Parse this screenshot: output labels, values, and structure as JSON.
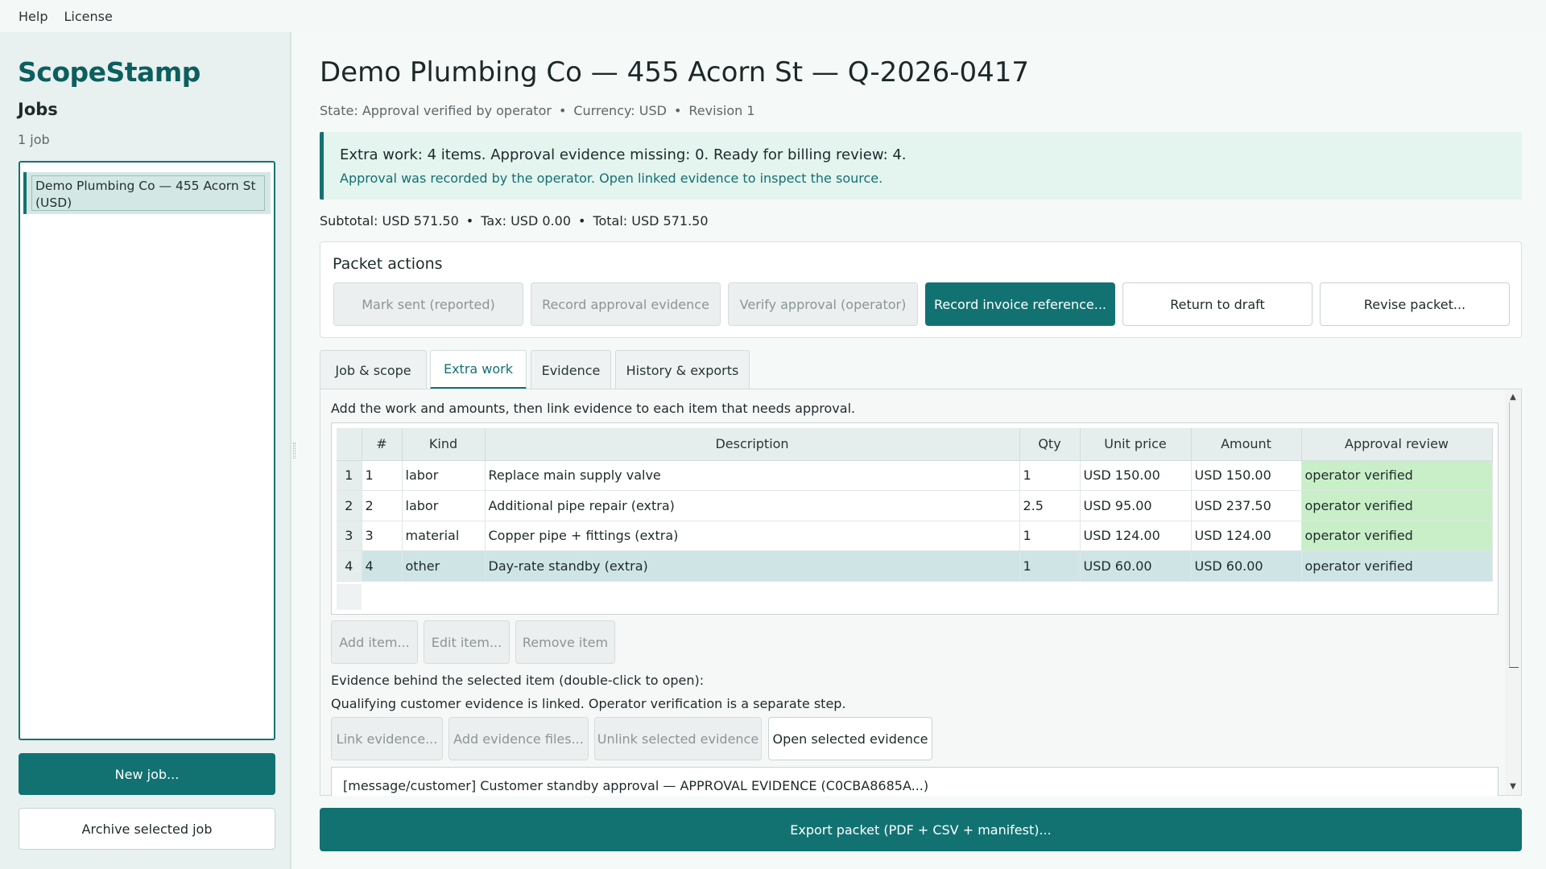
{
  "menubar": {
    "items": [
      "Help",
      "License"
    ]
  },
  "sidebar": {
    "brand": "ScopeStamp",
    "heading": "Jobs",
    "count": "1 job",
    "jobs": [
      {
        "label": "Demo Plumbing Co — 455 Acorn St (USD)"
      }
    ],
    "new_job": "New job...",
    "archive": "Archive selected job"
  },
  "main": {
    "title": "Demo Plumbing Co — 455 Acorn St — Q-2026-0417",
    "meta": {
      "state": "State: Approval verified by operator",
      "currency": "Currency: USD",
      "revision": "Revision 1",
      "sep": "•"
    },
    "banner": {
      "headline": "Extra work: 4 items. Approval evidence missing: 0. Ready for billing review: 4.",
      "detail": "Approval was recorded by the operator. Open linked evidence to inspect the source."
    },
    "totals": {
      "subtotal": "Subtotal: USD 571.50",
      "tax": "Tax: USD 0.00",
      "total": "Total: USD 571.50"
    },
    "packet": {
      "heading": "Packet actions",
      "buttons": {
        "mark_sent": "Mark sent (reported)",
        "record_approval": "Record approval evidence",
        "verify": "Verify approval (operator)",
        "record_invoice": "Record invoice reference...",
        "return_draft": "Return to draft",
        "revise": "Revise packet..."
      }
    },
    "tabs": [
      "Job & scope",
      "Extra work",
      "Evidence",
      "History & exports"
    ],
    "active_tab": "Extra work",
    "extra_work": {
      "intro": "Add the work and amounts, then link evidence to each item that needs approval.",
      "columns": [
        "#",
        "Kind",
        "Description",
        "Qty",
        "Unit price",
        "Amount",
        "Approval review"
      ],
      "rows": [
        {
          "row": "1",
          "num": "1",
          "kind": "labor",
          "desc": "Replace main supply valve",
          "qty": "1",
          "unit": "USD 150.00",
          "amount": "USD 150.00",
          "review": "operator verified"
        },
        {
          "row": "2",
          "num": "2",
          "kind": "labor",
          "desc": "Additional pipe repair (extra)",
          "qty": "2.5",
          "unit": "USD 95.00",
          "amount": "USD 237.50",
          "review": "operator verified"
        },
        {
          "row": "3",
          "num": "3",
          "kind": "material",
          "desc": "Copper pipe + fittings (extra)",
          "qty": "1",
          "unit": "USD 124.00",
          "amount": "USD 124.00",
          "review": "operator verified"
        },
        {
          "row": "4",
          "num": "4",
          "kind": "other",
          "desc": "Day-rate standby (extra)",
          "qty": "1",
          "unit": "USD 60.00",
          "amount": "USD 60.00",
          "review": "operator verified"
        }
      ],
      "item_buttons": {
        "add": "Add item...",
        "edit": "Edit item...",
        "remove": "Remove item"
      },
      "evidence_label": "Evidence behind the selected item (double-click to open):",
      "evidence_note": "Qualifying customer evidence is linked. Operator verification is a separate step.",
      "evidence_buttons": {
        "link": "Link evidence...",
        "add_files": "Add evidence files...",
        "unlink": "Unlink selected evidence",
        "open": "Open selected evidence"
      },
      "evidence_items": [
        "[message/customer] Customer standby approval — APPROVAL EVIDENCE (C0CBA8685A...)"
      ]
    },
    "export": "Export packet (PDF + CSV + manifest)..."
  },
  "colors": {
    "accent": "#127272",
    "verified": "#c8efc8",
    "selected_row": "#cfe5e5"
  }
}
